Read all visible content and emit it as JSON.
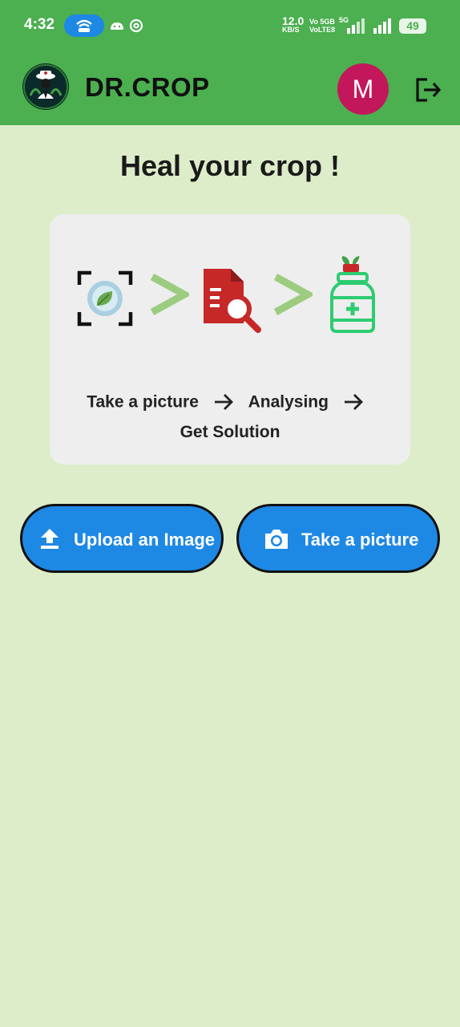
{
  "status_bar": {
    "time": "4:32",
    "net_speed": "12.0",
    "net_speed_unit": "KB/S",
    "volte_line1": "Vo 5GB",
    "volte_line2": "VoLTE8",
    "network_type": "5G",
    "battery": "49"
  },
  "app_bar": {
    "logo_text": "DR.CROP",
    "title": "DR.CROP",
    "avatar_letter": "M",
    "logout_icon": "logout-icon",
    "background_color": "#4caf50"
  },
  "main": {
    "heading": "Heal your crop !",
    "steps_card": {
      "icons": [
        "leaf-scan-icon",
        "chevron-right-icon",
        "document-search-icon",
        "chevron-right-icon",
        "medicine-bottle-icon"
      ],
      "step_1": "Take a picture",
      "step_2": "Analysing",
      "step_3": "Get Solution"
    },
    "buttons": {
      "upload": "Upload an Image",
      "camera": "Take a picture"
    }
  },
  "colors": {
    "background": "#ddedc9",
    "primary_green": "#4caf50",
    "button_blue": "#1e88e5",
    "avatar": "#c2185b"
  }
}
